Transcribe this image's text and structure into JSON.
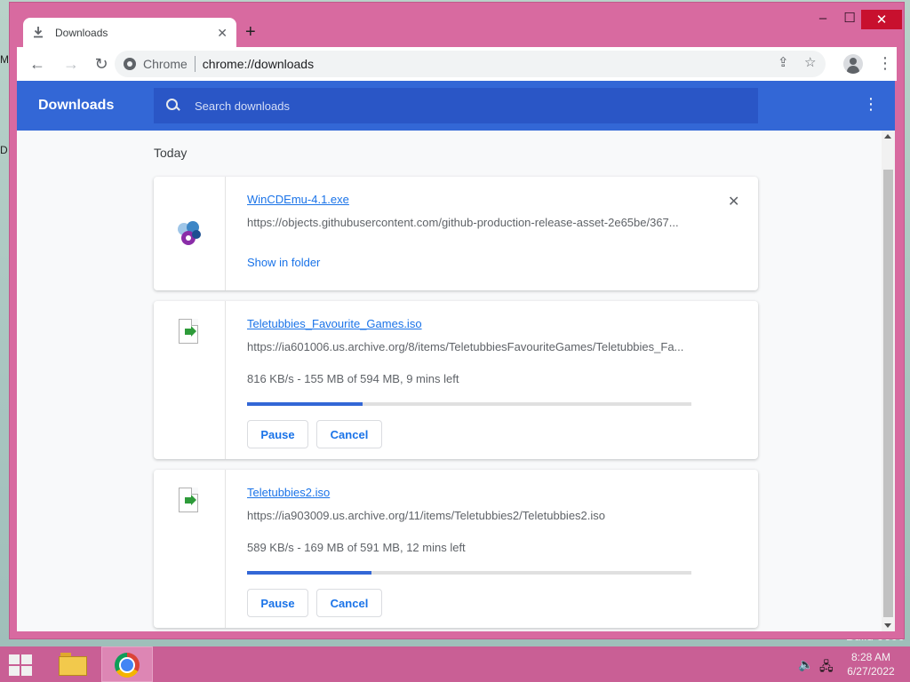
{
  "desktop": {
    "fragment_1": "M",
    "fragment_2": "D",
    "build": "Build 9600"
  },
  "window": {
    "tab_title": "Downloads",
    "new_tab": "+",
    "controls": {
      "minimize": "–",
      "maximize": "☐",
      "close": "✕"
    }
  },
  "toolbar": {
    "back": "←",
    "forward": "→",
    "reload": "↻",
    "omnibox_chip": "Chrome",
    "omnibox_url": "chrome://downloads",
    "share": "⇪",
    "bookmark": "☆",
    "menu": "⋮"
  },
  "downloads_page": {
    "title": "Downloads",
    "search_placeholder": "Search downloads",
    "menu": "⋮",
    "date_heading": "Today"
  },
  "downloads": [
    {
      "name": "WinCDEmu-4.1.exe",
      "url": "https://objects.githubusercontent.com/github-production-release-asset-2e65be/367...",
      "action": "Show in folder",
      "close": "✕",
      "icon": "wincdemu-icon"
    },
    {
      "name": "Teletubbies_Favourite_Games.iso",
      "url": "https://ia601006.us.archive.org/8/items/TeletubbiesFavouriteGames/Teletubbies_Fa...",
      "status": "816 KB/s - 155 MB of 594 MB, 9 mins left",
      "progress": 0.26,
      "pause": "Pause",
      "cancel": "Cancel",
      "icon": "file-icon"
    },
    {
      "name": "Teletubbies2.iso",
      "url": "https://ia903009.us.archive.org/11/items/Teletubbies2/Teletubbies2.iso",
      "status": "589 KB/s - 169 MB of 591 MB, 12 mins left",
      "progress": 0.28,
      "pause": "Pause",
      "cancel": "Cancel",
      "icon": "file-icon"
    }
  ],
  "taskbar": {
    "time": "8:28 AM",
    "date": "6/27/2022"
  },
  "colors": {
    "window_frame": "#d86aa0",
    "header_blue": "#3367d6",
    "link_blue": "#1a73e8",
    "taskbar": "#c95f95"
  }
}
